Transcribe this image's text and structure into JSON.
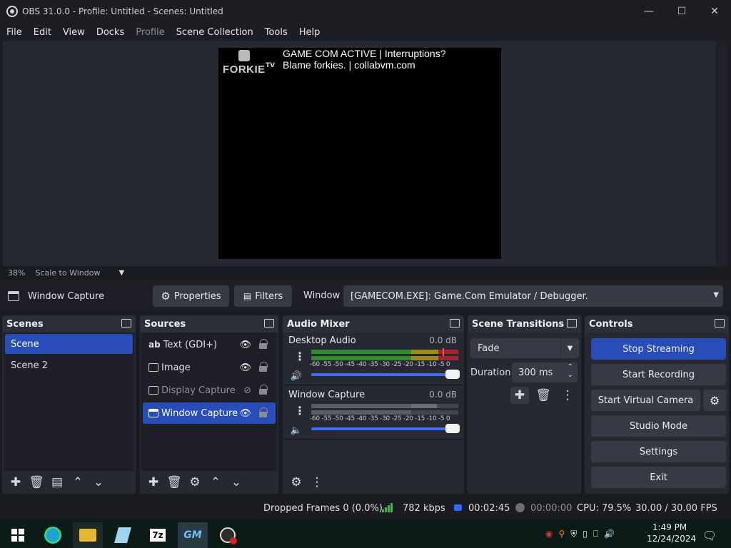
{
  "window": {
    "title": "OBS 31.0.0 - Profile: Untitled - Scenes: Untitled"
  },
  "menu": [
    "File",
    "Edit",
    "View",
    "Docks",
    "Profile",
    "Scene Collection",
    "Tools",
    "Help"
  ],
  "preview": {
    "logo_text": "FORKIE",
    "logo_sub": "TV",
    "overlay_line1": "GAME COM ACTIVE | Interruptions?",
    "overlay_line2": "Blame forkies. | collabvm.com"
  },
  "zoom": {
    "percent": "38%",
    "mode": "Scale to Window"
  },
  "source_bar": {
    "selected_source": "Window Capture",
    "properties": "Properties",
    "filters": "Filters",
    "window_label": "Window",
    "window_value": "[GAMECOM.EXE]: Game.Com Emulator / Debugger."
  },
  "scenes": {
    "title": "Scenes",
    "items": [
      "Scene",
      "Scene 2"
    ],
    "selected": 0
  },
  "sources": {
    "title": "Sources",
    "items": [
      {
        "name": "Text (GDI+)",
        "visible": true
      },
      {
        "name": "Image",
        "visible": true
      },
      {
        "name": "Display Capture",
        "visible": false
      },
      {
        "name": "Window Capture",
        "visible": true
      }
    ],
    "selected": 3
  },
  "audio_mixer": {
    "title": "Audio Mixer",
    "ticks": "-60 -55 -50 -45 -40 -35 -30 -25 -20 -15 -10 -5  0",
    "channels": [
      {
        "name": "Desktop Audio",
        "db": "0.0 dB",
        "muted": false
      },
      {
        "name": "Window Capture",
        "db": "0.0 dB",
        "muted": true
      }
    ]
  },
  "transitions": {
    "title": "Scene Transitions",
    "type": "Fade",
    "duration_label": "Duration",
    "duration_value": "300 ms"
  },
  "controls": {
    "title": "Controls",
    "stop_streaming": "Stop Streaming",
    "start_recording": "Start Recording",
    "start_virtual_camera": "Start Virtual Camera",
    "studio_mode": "Studio Mode",
    "settings": "Settings",
    "exit": "Exit"
  },
  "status": {
    "dropped_frames": "Dropped Frames 0 (0.0%)",
    "bitrate": "782 kbps",
    "stream_time": "00:02:45",
    "record_time": "00:00:00",
    "cpu": "CPU: 79.5%",
    "fps": "30.00 / 30.00 FPS"
  },
  "taskbar": {
    "time": "1:49 PM",
    "date": "12/24/2024",
    "apps": [
      "start",
      "edge",
      "file-explorer",
      "notepad",
      "7zip",
      "gamecom-emulator",
      "obs"
    ]
  },
  "colors": {
    "accent": "#284cb8",
    "button": "#373945",
    "panel": "#272932",
    "background": "#1b1c22"
  }
}
